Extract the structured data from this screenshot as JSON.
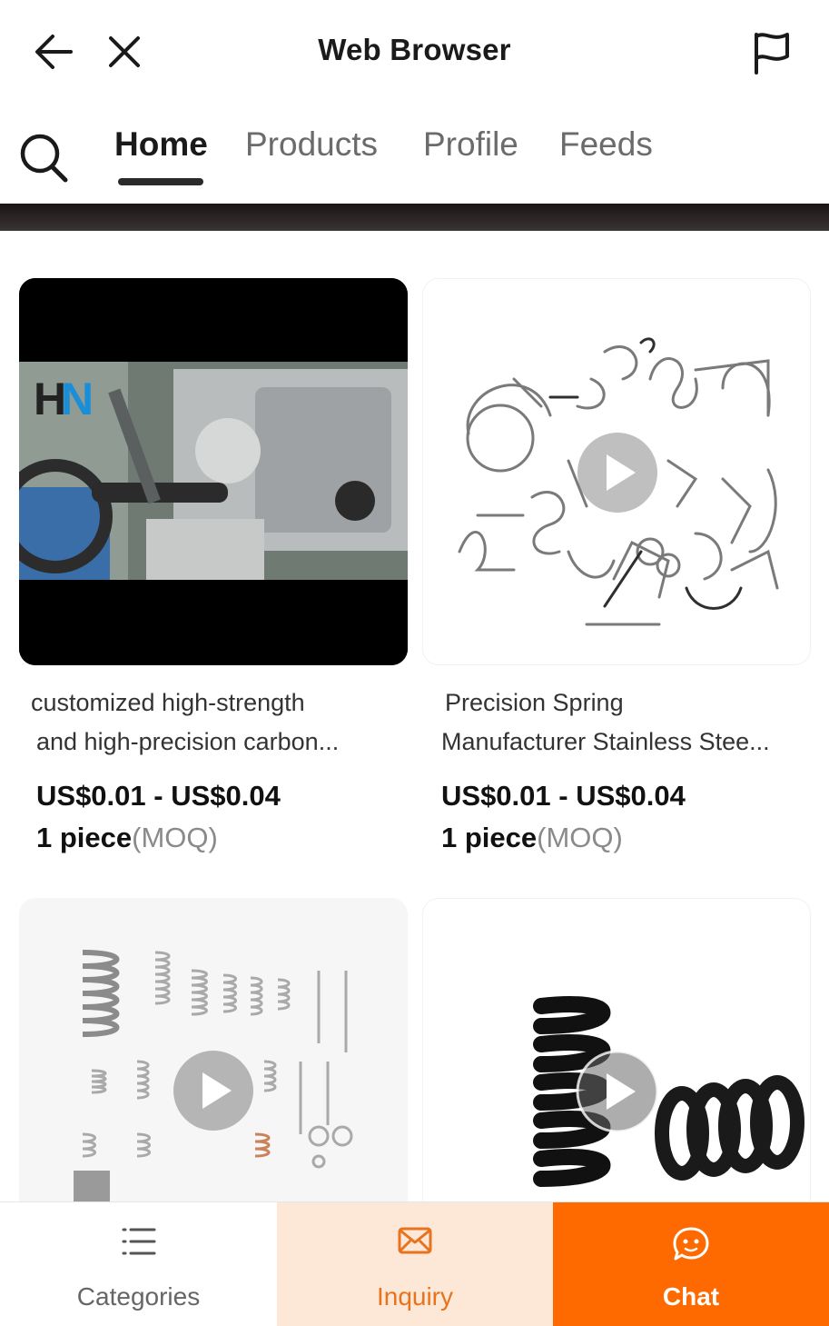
{
  "header": {
    "title": "Web Browser"
  },
  "tabs": [
    {
      "label": "Home",
      "active": true
    },
    {
      "label": "Products",
      "active": false
    },
    {
      "label": "Profile",
      "active": false
    },
    {
      "label": "Feeds",
      "active": false
    }
  ],
  "products": [
    {
      "title_line1": "customized high-strength",
      "title_line2": "and high-precision carbon...",
      "price": "US$0.01 - US$0.04",
      "moq_qty": "1 piece",
      "moq_label": "(MOQ)"
    },
    {
      "title_line1": "Precision Spring",
      "title_line2": "Manufacturer Stainless Stee...",
      "price": "US$0.01 - US$0.04",
      "moq_qty": "1 piece",
      "moq_label": "(MOQ)"
    },
    {},
    {}
  ],
  "bottom_bar": {
    "categories_label": "Categories",
    "inquiry_label": "Inquiry",
    "chat_label": "Chat"
  },
  "colors": {
    "accent": "#ff6a00",
    "inquiry_bg": "#fde7d6",
    "inquiry_text": "#e8731f"
  },
  "icons": [
    "back-arrow-icon",
    "close-icon",
    "flag-icon",
    "search-icon",
    "play-icon",
    "list-icon",
    "mail-icon",
    "chat-bubble-icon"
  ]
}
